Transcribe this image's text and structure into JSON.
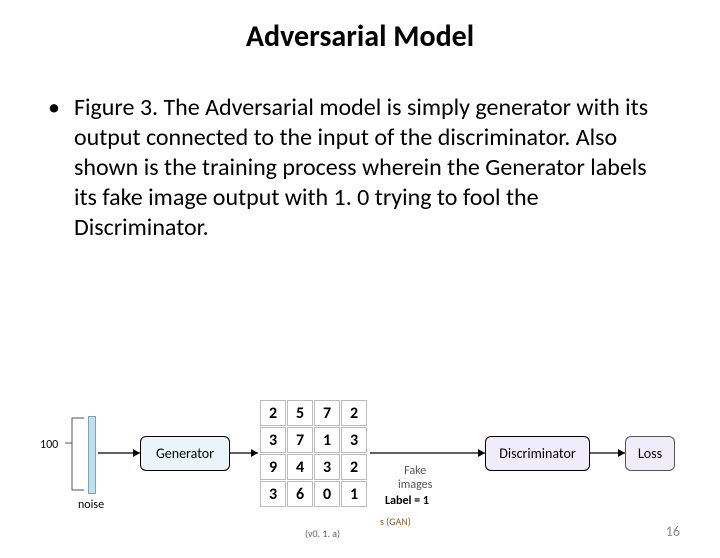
{
  "title": "Adversarial Model",
  "bullet": "Figure 3. The Adversarial model is simply generator with its output connected to the input of the discriminator. Also shown is the training process wherein the Generator labels its fake image output with 1. 0 trying to fool the Discriminator.",
  "fig": {
    "input_dim": "100",
    "noise_label": "noise",
    "generator": "Generator",
    "discriminator": "Discriminator",
    "loss": "Loss",
    "fake_images": "Fake\nimages",
    "label_eq": "Label = 1",
    "digits": [
      [
        "2",
        "5",
        "7",
        "2"
      ],
      [
        "3",
        "7",
        "1",
        "3"
      ],
      [
        "9",
        "4",
        "3",
        "2"
      ],
      [
        "3",
        "6",
        "0",
        "1"
      ]
    ]
  },
  "footer": {
    "ref": "s (GAN)",
    "ver": "(v0. 1. a)"
  },
  "page": "16"
}
